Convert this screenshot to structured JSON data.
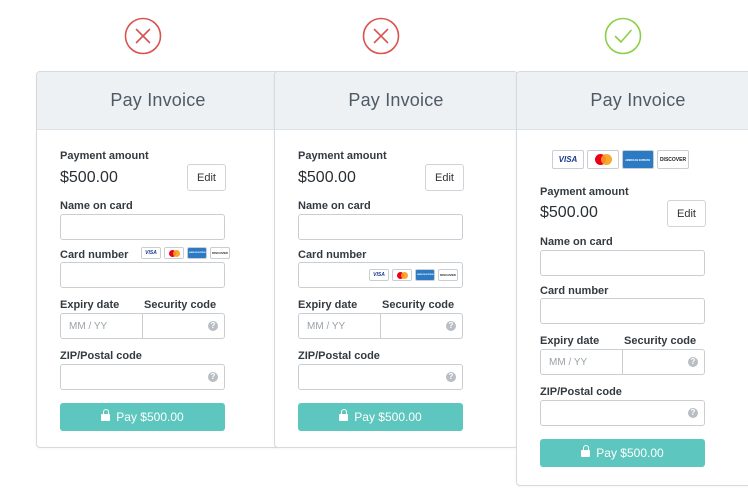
{
  "colors": {
    "reject": "#d9534f",
    "accept": "#8bd048",
    "pay_button": "#5dc7bf",
    "header_bg": "#edf1f4"
  },
  "variants": [
    {
      "status_icon": "x-icon"
    },
    {
      "status_icon": "x-icon"
    },
    {
      "status_icon": "check-icon"
    }
  ],
  "form": {
    "title": "Pay Invoice",
    "payment_amount_label": "Payment amount",
    "amount": "$500.00",
    "edit_label": "Edit",
    "name_label": "Name on card",
    "card_number_label": "Card number",
    "expiry_label": "Expiry date",
    "security_label": "Security code",
    "expiry_placeholder": "MM / YY",
    "zip_label": "ZIP/Postal code",
    "help_glyph": "?",
    "pay_label": "Pay $500.00",
    "card_logos": {
      "visa": "VISA",
      "mastercard": "MasterCard",
      "amex": "AMERICAN EXPRESS",
      "discover": "DISCOVER"
    }
  }
}
